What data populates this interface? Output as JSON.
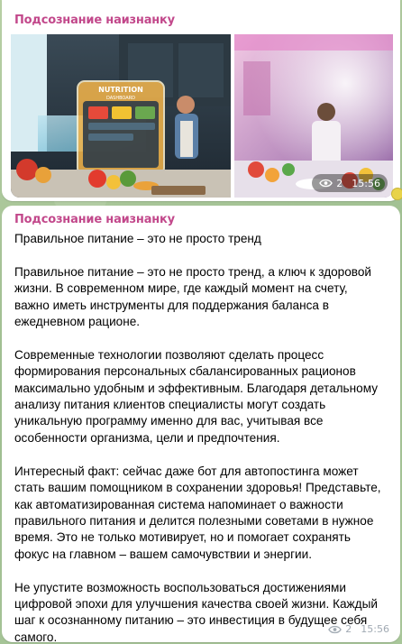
{
  "channel": {
    "name": "Подсознание наизнанку"
  },
  "post1": {
    "sender": "Подсознание наизнанку",
    "photo_left_caption": "NUTRITION",
    "photo_left_subcaption": "DASHBOARD",
    "views": "2",
    "time": "15:56"
  },
  "post2": {
    "sender": "Подсознание наизнанку",
    "body": "Правильное питание – это не просто тренд\n\nПравильное питание – это не просто тренд, а ключ к здоровой жизни. В современном мире, где каждый момент на счету, важно иметь инструменты для поддержания баланса в ежедневном рационе.\n\nСовременные технологии позволяют сделать процесс формирования персональных сбалансированных рационов максимально удобным и эффективным. Благодаря детальному анализу питания клиентов специалисты могут создать уникальную программу именно для вас, учитывая все особенности организма, цели и предпочтения.\n\nИнтересный факт: сейчас даже бот для автопостинга может стать вашим помощником в сохранении здоровья! Представьте, как автоматизированная система напоминает о важности правильного питания и делится полезными советами в нужное время. Это не только мотивирует, но и помогает сохранять фокус на главном – вашем самочувствии и энергии.\n\nНе упустите возможность воспользоваться достижениями цифровой эпохи для улучшения качества своей жизни. Каждый шаг к осознанному питанию – это инвестиция в будущее себя самого.",
    "views": "2",
    "time": "15:56"
  },
  "colors": {
    "sender": "#c2488b",
    "meta": "#a1aab3",
    "background": "#a7c39a"
  },
  "icons": {
    "views": "eye-icon",
    "reaction": "emoji-reaction-icon"
  }
}
